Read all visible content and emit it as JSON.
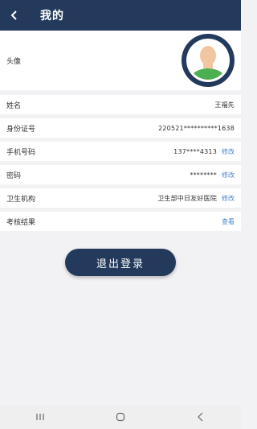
{
  "header": {
    "title": "我的"
  },
  "profile": {
    "avatar_label": "头像",
    "rows": [
      {
        "label": "姓名",
        "value": "王福先"
      },
      {
        "label": "身份证号",
        "value": "220521**********1638"
      },
      {
        "label": "手机号码",
        "value": "137****4313",
        "action": "修改"
      },
      {
        "label": "密码",
        "value": "********",
        "action": "修改"
      },
      {
        "label": "卫生机构",
        "value": "卫生部中日友好医院",
        "action": "修改"
      },
      {
        "label": "考核结果",
        "value": "",
        "action": "查看"
      }
    ]
  },
  "logout_label": "退出登录",
  "colors": {
    "primary": "#233a5d",
    "link": "#4a86c8",
    "background": "#f2f2f4"
  },
  "icons": {
    "back": "chevron-left-icon",
    "avatar": "user-avatar-icon"
  }
}
